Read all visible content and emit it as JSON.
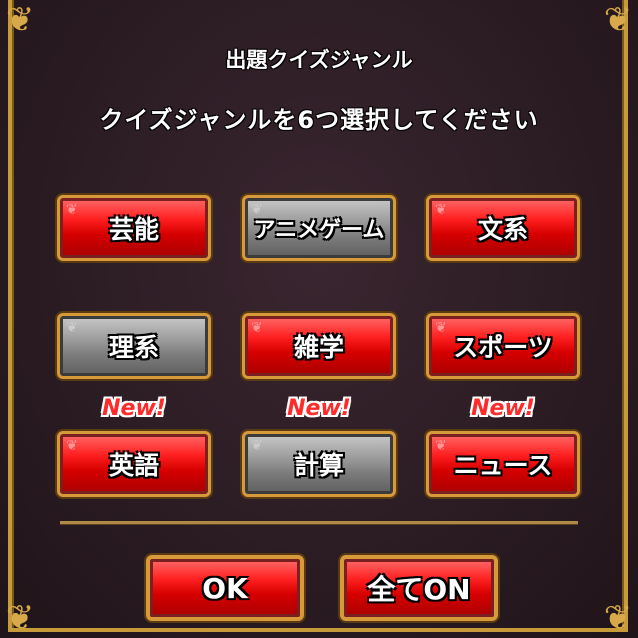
{
  "header": {
    "title": "出題クイズジャンル",
    "subtitle": "クイズジャンルを6つ選択してください"
  },
  "genres": [
    {
      "label": "芸能",
      "selected": true,
      "new": false
    },
    {
      "label": "アニメゲーム",
      "selected": false,
      "new": false
    },
    {
      "label": "文系",
      "selected": true,
      "new": false
    },
    {
      "label": "理系",
      "selected": false,
      "new": false
    },
    {
      "label": "雑学",
      "selected": true,
      "new": false
    },
    {
      "label": "スポーツ",
      "selected": true,
      "new": false
    },
    {
      "label": "英語",
      "selected": true,
      "new": true
    },
    {
      "label": "計算",
      "selected": false,
      "new": true
    },
    {
      "label": "ニュース",
      "selected": true,
      "new": true
    }
  ],
  "new_badge": "New!",
  "footer": {
    "ok_label": "OK",
    "all_on_label": "全てON"
  },
  "colors": {
    "selected": "#e00000",
    "unselected": "#8a8a8a",
    "frame": "#c79a3a",
    "new_badge": "#ff2a2a"
  }
}
